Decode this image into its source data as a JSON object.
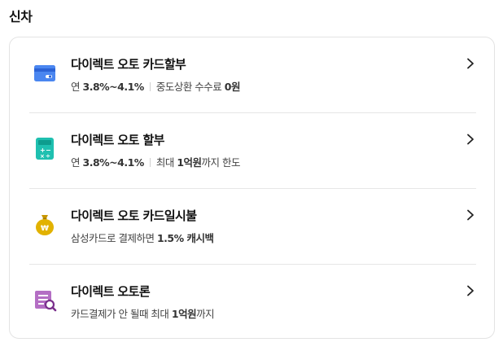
{
  "section": {
    "title": "신차"
  },
  "items": [
    {
      "title": "다이렉트 오토 카드할부",
      "desc_pre": "연",
      "desc_bold1": "3.8%~4.1%",
      "desc_mid": "중도상환 수수료",
      "desc_bold2": "0원",
      "desc_post": "",
      "icon": "card-icon"
    },
    {
      "title": "다이렉트 오토 할부",
      "desc_pre": "연",
      "desc_bold1": "3.8%~4.1%",
      "desc_mid": "최대",
      "desc_bold2": "1억원",
      "desc_post": "까지 한도",
      "icon": "calculator-icon"
    },
    {
      "title": "다이렉트 오토 카드일시불",
      "desc_pre": "삼성카드로 결제하면",
      "desc_bold1": "1.5% 캐시백",
      "icon": "money-bag-icon"
    },
    {
      "title": "다이렉트 오토론",
      "desc_pre": "카드결제가 안 될때 최대",
      "desc_bold1": "1억원",
      "desc_post": "까지",
      "icon": "document-search-icon"
    }
  ],
  "colors": {
    "card_icon_blue": "#3d7df0",
    "calculator_teal": "#1fc0b0",
    "money_bag_gold": "#e2b200",
    "doc_purple": "#a25bb3"
  }
}
